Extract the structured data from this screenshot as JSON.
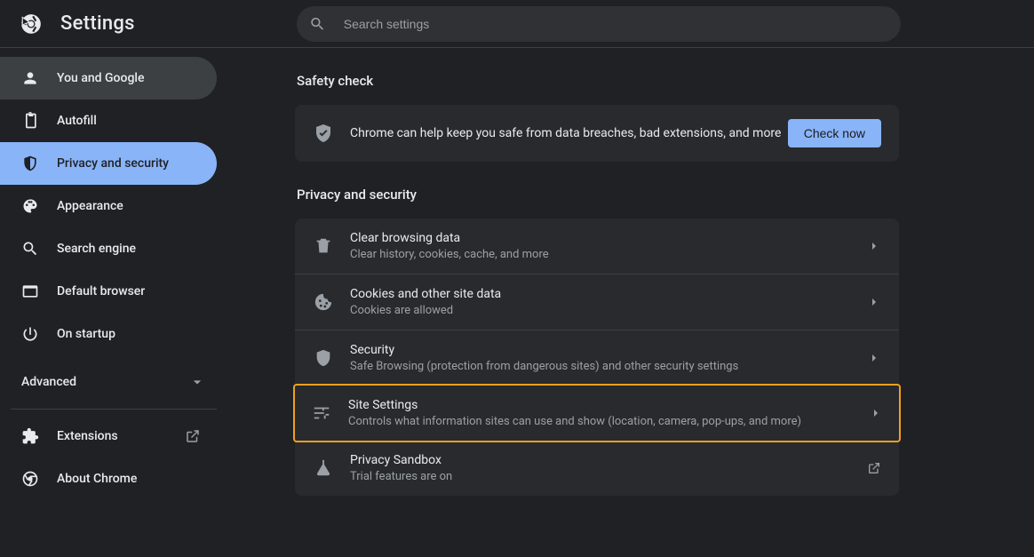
{
  "app": {
    "title": "Settings"
  },
  "search": {
    "placeholder": "Search settings"
  },
  "sidebar": {
    "items": [
      {
        "id": "you-and-google",
        "label": "You and Google",
        "icon": "person"
      },
      {
        "id": "autofill",
        "label": "Autofill",
        "icon": "clipboard"
      },
      {
        "id": "privacy-security",
        "label": "Privacy and security",
        "icon": "shield-half"
      },
      {
        "id": "appearance",
        "label": "Appearance",
        "icon": "palette"
      },
      {
        "id": "search-engine",
        "label": "Search engine",
        "icon": "search"
      },
      {
        "id": "default-browser",
        "label": "Default browser",
        "icon": "window"
      },
      {
        "id": "on-startup",
        "label": "On startup",
        "icon": "power"
      }
    ],
    "advanced_label": "Advanced",
    "footer_items": [
      {
        "id": "extensions",
        "label": "Extensions",
        "icon": "puzzle",
        "external": true
      },
      {
        "id": "about-chrome",
        "label": "About Chrome",
        "icon": "chrome",
        "external": false
      }
    ],
    "hover_id": "you-and-google",
    "selected_id": "privacy-security"
  },
  "safety_check": {
    "section_title": "Safety check",
    "message": "Chrome can help keep you safe from data breaches, bad extensions, and more",
    "button": "Check now"
  },
  "privacy": {
    "section_title": "Privacy and security",
    "highlight_id": "site-settings",
    "rows": [
      {
        "id": "clear-browsing-data",
        "icon": "trash",
        "title": "Clear browsing data",
        "sub": "Clear history, cookies, cache, and more",
        "action": "arrow"
      },
      {
        "id": "cookies",
        "icon": "cookie",
        "title": "Cookies and other site data",
        "sub": "Cookies are allowed",
        "action": "arrow"
      },
      {
        "id": "security",
        "icon": "shield",
        "title": "Security",
        "sub": "Safe Browsing (protection from dangerous sites) and other security settings",
        "action": "arrow"
      },
      {
        "id": "site-settings",
        "icon": "tune",
        "title": "Site Settings",
        "sub": "Controls what information sites can use and show (location, camera, pop-ups, and more)",
        "action": "arrow"
      },
      {
        "id": "privacy-sandbox",
        "icon": "flask",
        "title": "Privacy Sandbox",
        "sub": "Trial features are on",
        "action": "external"
      }
    ]
  }
}
